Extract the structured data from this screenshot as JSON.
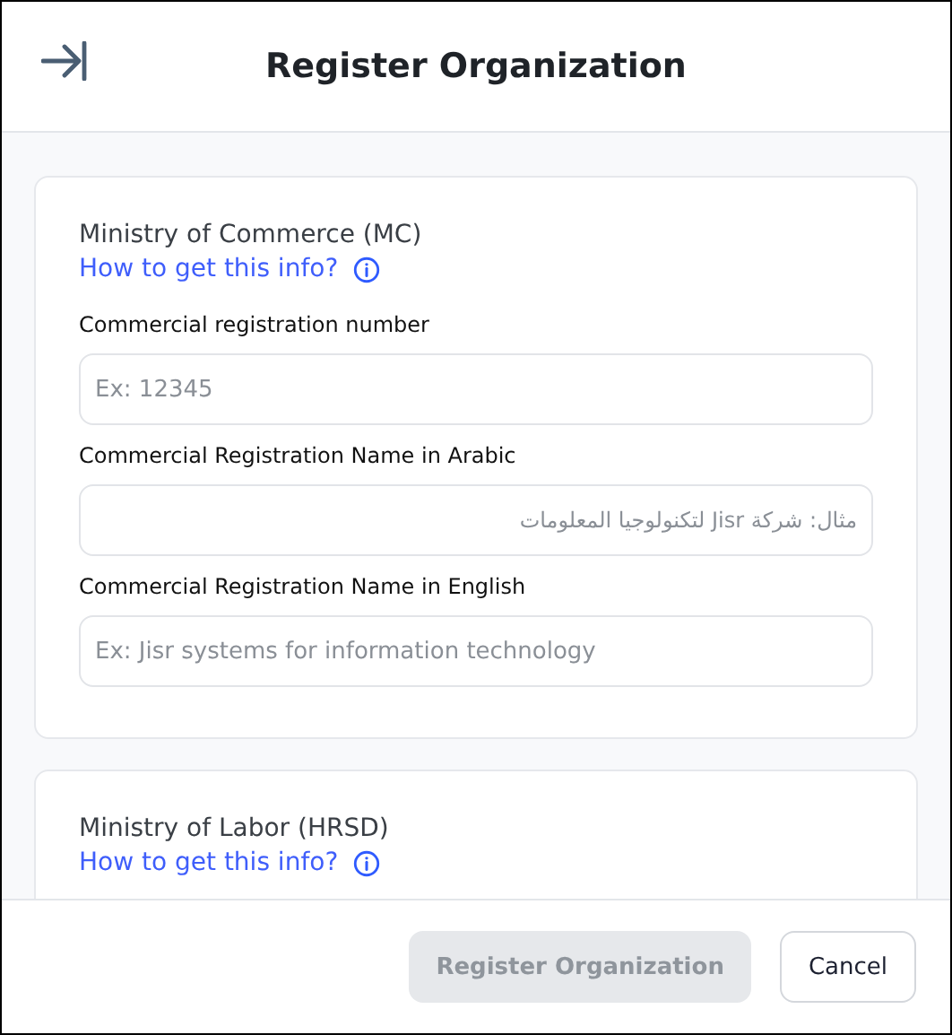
{
  "header": {
    "title": "Register Organization"
  },
  "sections": [
    {
      "title": "Ministry of Commerce (MC)",
      "help_link": "How to get this info?",
      "fields": [
        {
          "label": "Commercial registration number",
          "placeholder": "Ex: 12345",
          "kind": "ltr"
        },
        {
          "label": "Commercial Registration Name in Arabic",
          "placeholder": "مثال: شركة Jisr لتكنولوجيا المعلومات",
          "kind": "rtl"
        },
        {
          "label": "Commercial Registration Name in English",
          "placeholder": "Ex: Jisr systems for information technology",
          "kind": "ltr"
        }
      ]
    },
    {
      "title": "Ministry of Labor (HRSD)",
      "help_link": "How to get this info?"
    }
  ],
  "footer": {
    "buttons": [
      {
        "label": "Register Organization",
        "kind": "primary",
        "disabled": true
      },
      {
        "label": "Cancel",
        "kind": "secondary",
        "disabled": false
      }
    ]
  }
}
